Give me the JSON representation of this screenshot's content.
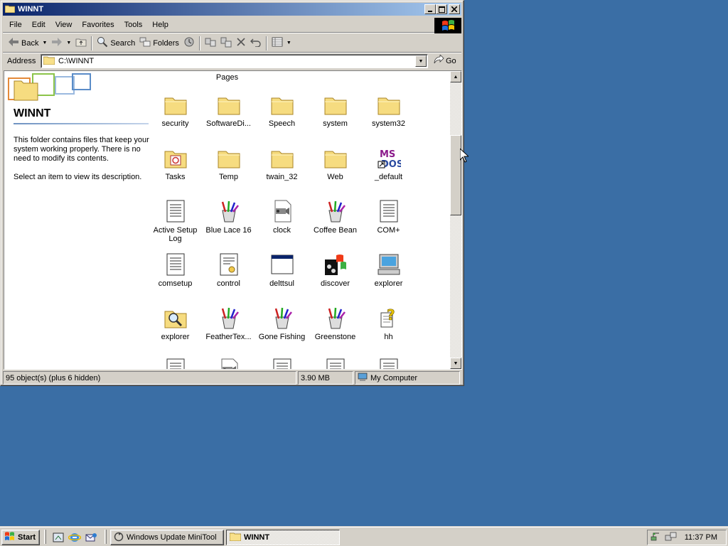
{
  "window": {
    "title": "WINNT",
    "buttons": {
      "minimize": "_",
      "maximize": "□",
      "close": "×"
    }
  },
  "menu": [
    "File",
    "Edit",
    "View",
    "Favorites",
    "Tools",
    "Help"
  ],
  "toolbar": {
    "back_label": "Back",
    "search_label": "Search",
    "folders_label": "Folders"
  },
  "address": {
    "label": "Address",
    "value": "C:\\WINNT",
    "go_label": "Go"
  },
  "left_pane": {
    "folder_name": "WINNT",
    "description": "This folder contains files that keep your system working properly. There is no need to modify its contents.",
    "hint": "Select an item to view its description."
  },
  "files": {
    "partial_top": "Pages",
    "items": [
      {
        "label": "security",
        "icon": "folder-icon"
      },
      {
        "label": "SoftwareDi...",
        "icon": "folder-icon"
      },
      {
        "label": "Speech",
        "icon": "folder-icon"
      },
      {
        "label": "system",
        "icon": "folder-icon"
      },
      {
        "label": "system32",
        "icon": "folder-icon"
      },
      {
        "label": "Tasks",
        "icon": "tasks-folder-icon"
      },
      {
        "label": "Temp",
        "icon": "folder-icon"
      },
      {
        "label": "twain_32",
        "icon": "folder-icon"
      },
      {
        "label": "Web",
        "icon": "folder-icon"
      },
      {
        "label": "_default",
        "icon": "ms-dos-shortcut-icon"
      },
      {
        "label": "Active Setup Log",
        "icon": "text-file-icon"
      },
      {
        "label": "Blue Lace 16",
        "icon": "paint-bitmap-icon"
      },
      {
        "label": "clock",
        "icon": "clock-avi-icon"
      },
      {
        "label": "Coffee Bean",
        "icon": "paint-bitmap-icon"
      },
      {
        "label": "COM+",
        "icon": "text-file-icon"
      },
      {
        "label": "comsetup",
        "icon": "text-file-icon"
      },
      {
        "label": "control",
        "icon": "config-file-icon"
      },
      {
        "label": "delttsul",
        "icon": "window-app-icon"
      },
      {
        "label": "discover",
        "icon": "discover-app-icon"
      },
      {
        "label": "explorer",
        "icon": "computer-app-icon"
      },
      {
        "label": "explorer",
        "icon": "search-folder-icon"
      },
      {
        "label": "FeatherTex...",
        "icon": "paint-bitmap-icon"
      },
      {
        "label": "Gone Fishing",
        "icon": "paint-bitmap-icon"
      },
      {
        "label": "Greenstone",
        "icon": "paint-bitmap-icon"
      },
      {
        "label": "hh",
        "icon": "help-app-icon"
      }
    ]
  },
  "statusbar": {
    "objects": "95 object(s) (plus 6 hidden)",
    "size": "3.90 MB",
    "location": "My Computer"
  },
  "taskbar": {
    "start_label": "Start",
    "tasks": [
      {
        "label": "Windows Update MiniTool",
        "active": false
      },
      {
        "label": "WINNT",
        "active": true
      }
    ],
    "clock": "11:37 PM"
  },
  "colors": {
    "desktop": "#3a6ea5",
    "titlebar_start": "#0a246a",
    "titlebar_end": "#a6caf0",
    "face": "#d4d0c8"
  }
}
